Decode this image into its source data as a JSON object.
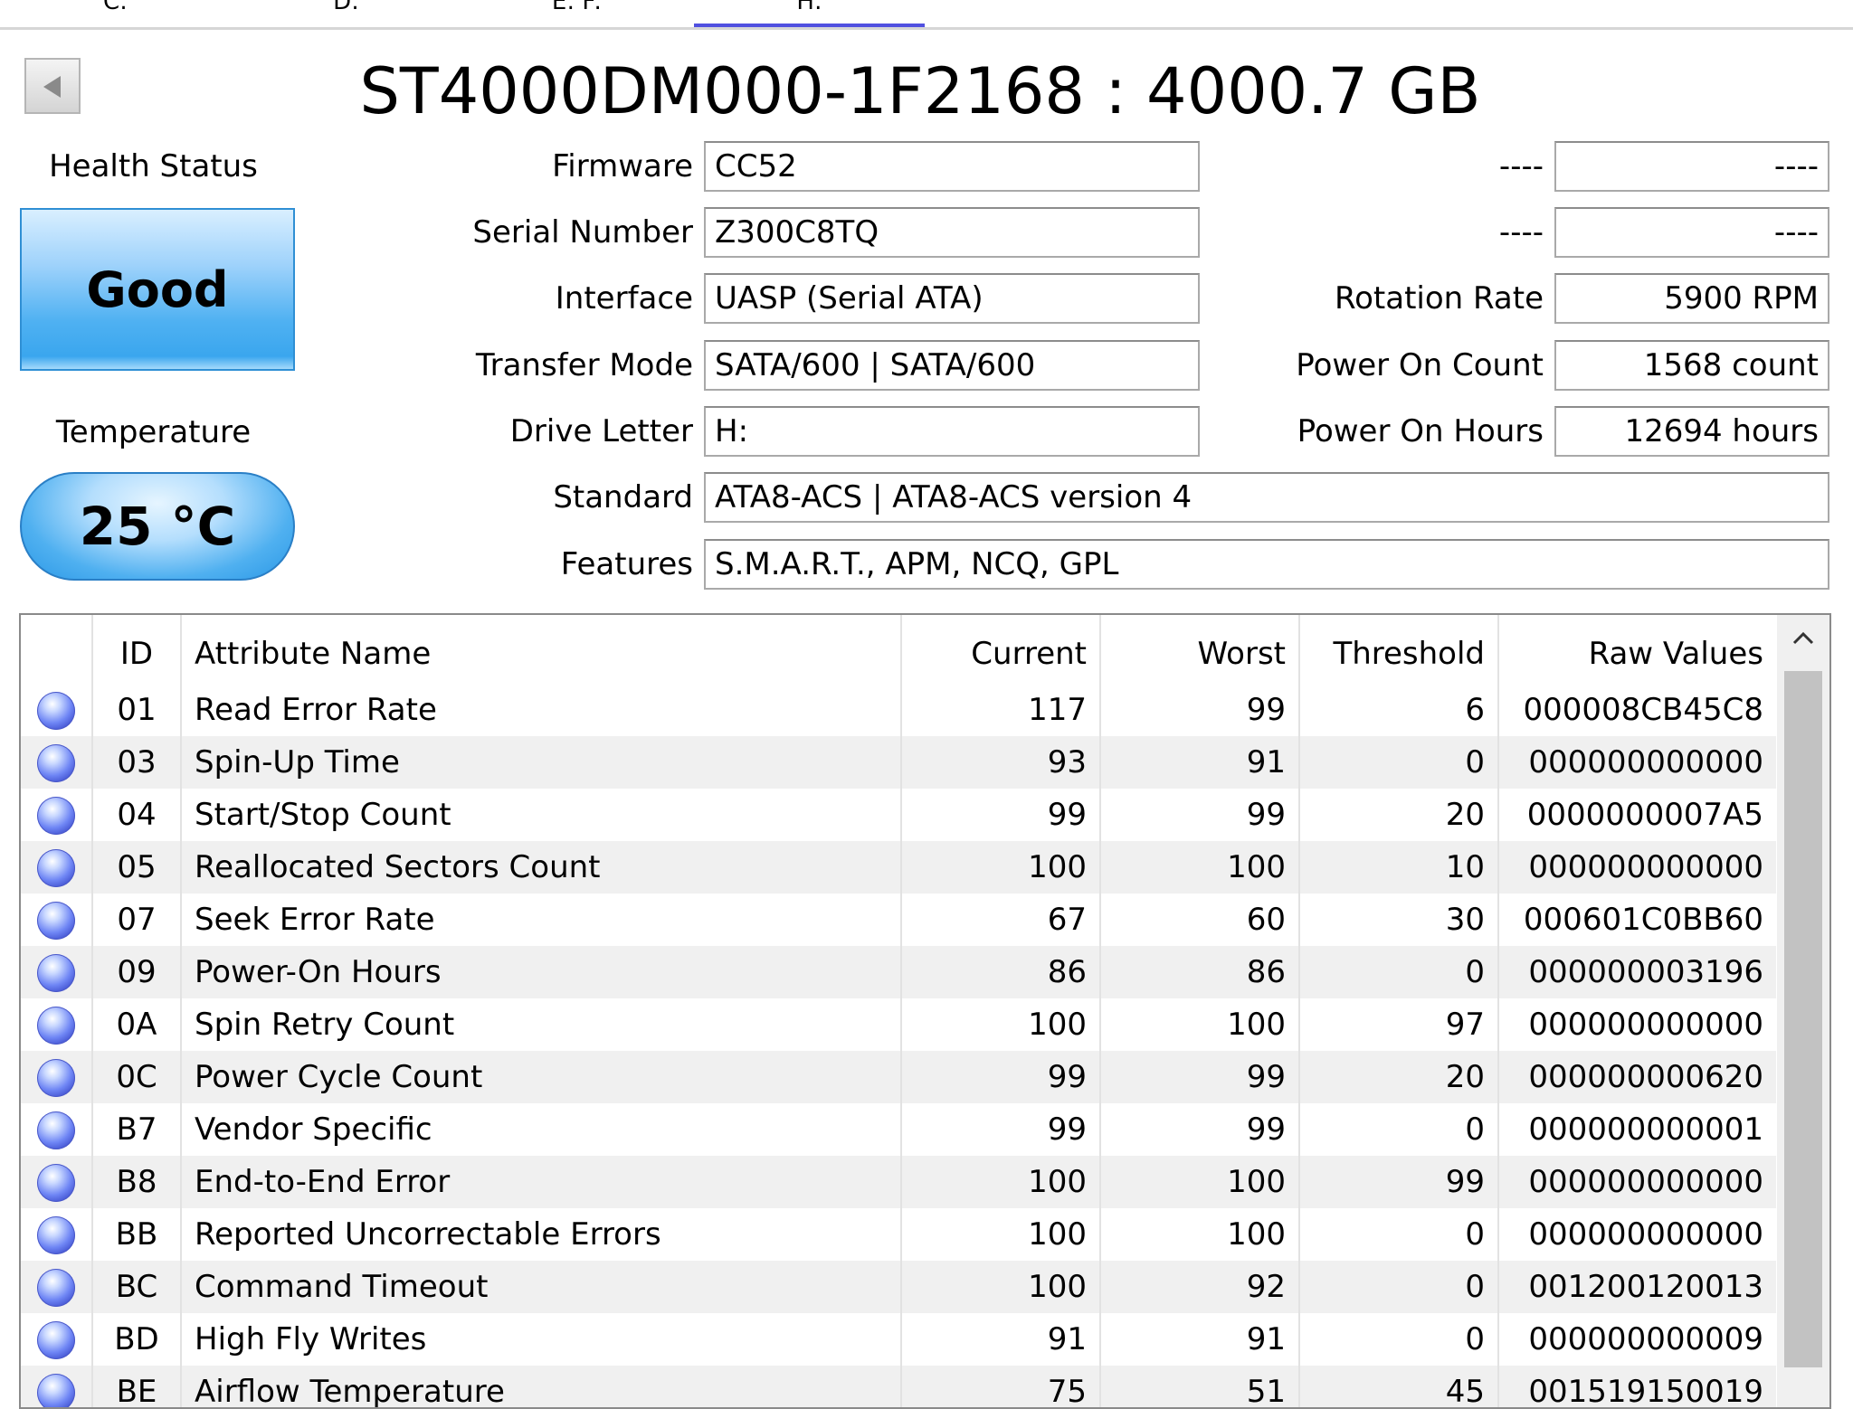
{
  "tabs": [
    {
      "label": "C:"
    },
    {
      "label": "D:"
    },
    {
      "label": "E: F:"
    },
    {
      "label": "H:"
    }
  ],
  "title": "ST4000DM000-1F2168 : 4000.7 GB",
  "health": {
    "label": "Health Status",
    "value": "Good"
  },
  "temperature": {
    "label": "Temperature",
    "value": "25 °C"
  },
  "info": {
    "firmware": {
      "label": "Firmware",
      "value": "CC52"
    },
    "serial": {
      "label": "Serial Number",
      "value": "Z300C8TQ"
    },
    "interface": {
      "label": "Interface",
      "value": "UASP (Serial ATA)"
    },
    "transfer_mode": {
      "label": "Transfer Mode",
      "value": "SATA/600 | SATA/600"
    },
    "drive_letter": {
      "label": "Drive Letter",
      "value": "H:"
    },
    "standard": {
      "label": "Standard",
      "value": "ATA8-ACS | ATA8-ACS version 4"
    },
    "features": {
      "label": "Features",
      "value": "S.M.A.R.T., APM, NCQ, GPL"
    },
    "blank1": {
      "label": "----",
      "value": "----"
    },
    "blank2": {
      "label": "----",
      "value": "----"
    },
    "rotation": {
      "label": "Rotation Rate",
      "value": "5900 RPM"
    },
    "power_on_count": {
      "label": "Power On Count",
      "value": "1568 count"
    },
    "power_on_hours": {
      "label": "Power On Hours",
      "value": "12694 hours"
    }
  },
  "smart": {
    "headers": {
      "id": "ID",
      "name": "Attribute Name",
      "current": "Current",
      "worst": "Worst",
      "threshold": "Threshold",
      "raw": "Raw Values"
    },
    "rows": [
      {
        "id": "01",
        "name": "Read Error Rate",
        "current": "117",
        "worst": "99",
        "threshold": "6",
        "raw": "000008CB45C8"
      },
      {
        "id": "03",
        "name": "Spin-Up Time",
        "current": "93",
        "worst": "91",
        "threshold": "0",
        "raw": "000000000000"
      },
      {
        "id": "04",
        "name": "Start/Stop Count",
        "current": "99",
        "worst": "99",
        "threshold": "20",
        "raw": "0000000007A5"
      },
      {
        "id": "05",
        "name": "Reallocated Sectors Count",
        "current": "100",
        "worst": "100",
        "threshold": "10",
        "raw": "000000000000"
      },
      {
        "id": "07",
        "name": "Seek Error Rate",
        "current": "67",
        "worst": "60",
        "threshold": "30",
        "raw": "000601C0BB60"
      },
      {
        "id": "09",
        "name": "Power-On Hours",
        "current": "86",
        "worst": "86",
        "threshold": "0",
        "raw": "000000003196"
      },
      {
        "id": "0A",
        "name": "Spin Retry Count",
        "current": "100",
        "worst": "100",
        "threshold": "97",
        "raw": "000000000000"
      },
      {
        "id": "0C",
        "name": "Power Cycle Count",
        "current": "99",
        "worst": "99",
        "threshold": "20",
        "raw": "000000000620"
      },
      {
        "id": "B7",
        "name": "Vendor Specific",
        "current": "99",
        "worst": "99",
        "threshold": "0",
        "raw": "000000000001"
      },
      {
        "id": "B8",
        "name": "End-to-End Error",
        "current": "100",
        "worst": "100",
        "threshold": "99",
        "raw": "000000000000"
      },
      {
        "id": "BB",
        "name": "Reported Uncorrectable Errors",
        "current": "100",
        "worst": "100",
        "threshold": "0",
        "raw": "000000000000"
      },
      {
        "id": "BC",
        "name": "Command Timeout",
        "current": "100",
        "worst": "92",
        "threshold": "0",
        "raw": "001200120013"
      },
      {
        "id": "BD",
        "name": "High Fly Writes",
        "current": "91",
        "worst": "91",
        "threshold": "0",
        "raw": "000000000009"
      },
      {
        "id": "BE",
        "name": "Airflow Temperature",
        "current": "75",
        "worst": "51",
        "threshold": "45",
        "raw": "001519150019"
      }
    ]
  },
  "colors": {
    "health_good": "#3aa6ee",
    "active_tab": "#5050e0",
    "status_dot": "#5a6ee8"
  },
  "icons": {
    "back": "back-arrow-icon",
    "scroll_up": "chevron-up-icon",
    "status": "status-dot-icon"
  }
}
